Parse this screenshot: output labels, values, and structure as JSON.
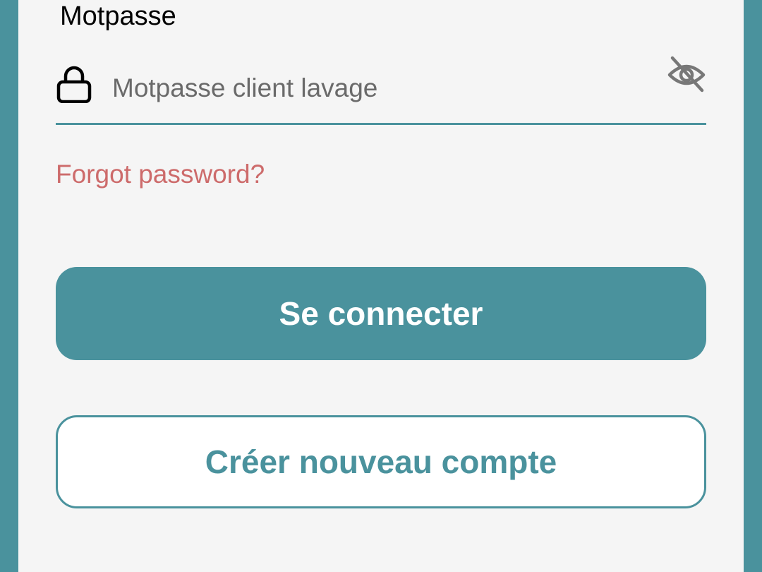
{
  "form": {
    "password_label": "Motpasse",
    "password_placeholder": "Motpasse client lavage",
    "password_value": "",
    "forgot_password": "Forgot password?",
    "login_button": "Se connecter",
    "create_account_button": "Créer nouveau compte"
  },
  "icons": {
    "lock": "lock-icon",
    "visibility_toggle": "eye-off-icon"
  },
  "colors": {
    "accent": "#4a929d",
    "background": "#f5f5f5",
    "link": "#cd6b6b",
    "placeholder": "#6a6a6a"
  }
}
